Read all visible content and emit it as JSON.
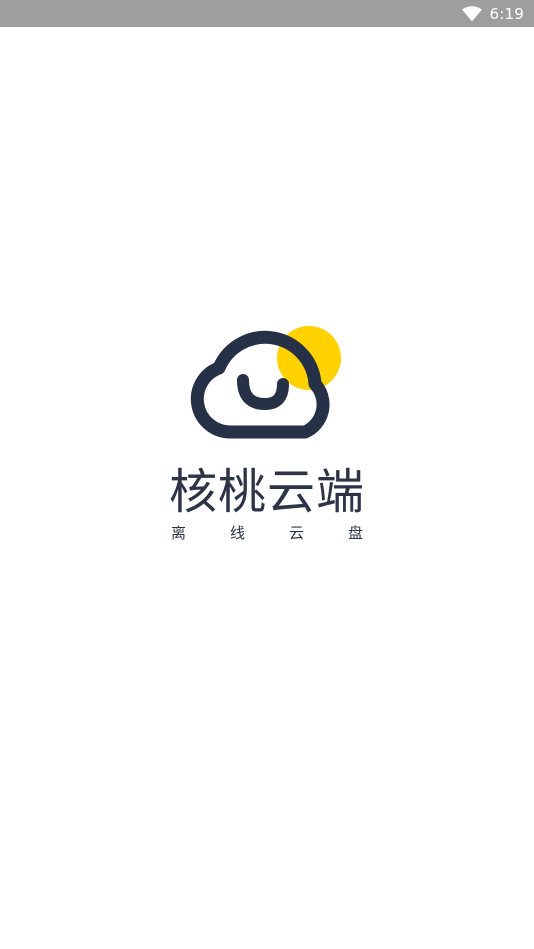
{
  "status_bar": {
    "time": "6:19",
    "icons": [
      "wifi-icon"
    ],
    "background": "#9e9e9e"
  },
  "splash": {
    "logo": {
      "name": "cloud-logo",
      "cloud_color": "#263147",
      "sun_color": "#ffd200"
    },
    "title": "核桃云端",
    "subtitle": "离线云盘",
    "text_color": "#2c3446"
  }
}
